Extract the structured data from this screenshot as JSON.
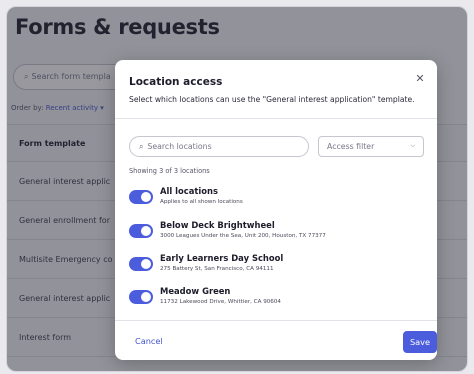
{
  "page": {
    "title": "Forms & requests",
    "search_placeholder": "Search form templa",
    "order_label": "Order by:",
    "order_value": "Recent activity",
    "table_header": "Form template",
    "rows": [
      "General interest applic",
      "General enrollment for",
      "Multisite Emergency co",
      "General interest applic",
      "Interest form"
    ]
  },
  "modal": {
    "title": "Location access",
    "description": "Select which locations can use the \"General interest application\" template.",
    "search_placeholder": "Search locations",
    "filter_label": "Access filter",
    "count_text": "Showing 3 of 3 locations",
    "locations": [
      {
        "name": "All locations",
        "address": "Applies to all shown locations",
        "enabled": true
      },
      {
        "name": "Below Deck Brightwheel",
        "address": "3000 Leagues Under the Sea, Unit 200, Houston, TX 77377",
        "enabled": true
      },
      {
        "name": "Early Learners Day School",
        "address": "275 Battery St, San Francisco, CA 94111",
        "enabled": true
      },
      {
        "name": "Meadow Green",
        "address": "11732 Lakewood Drive, Whittier, CA 90604",
        "enabled": true
      }
    ],
    "cancel_label": "Cancel",
    "save_label": "Save"
  },
  "icons": {
    "search": "search-icon",
    "close": "close-icon",
    "chevron": "chevron-down-icon"
  },
  "colors": {
    "accent": "#4b5ddc",
    "link": "#4453cc",
    "overlay": "#28283a"
  }
}
